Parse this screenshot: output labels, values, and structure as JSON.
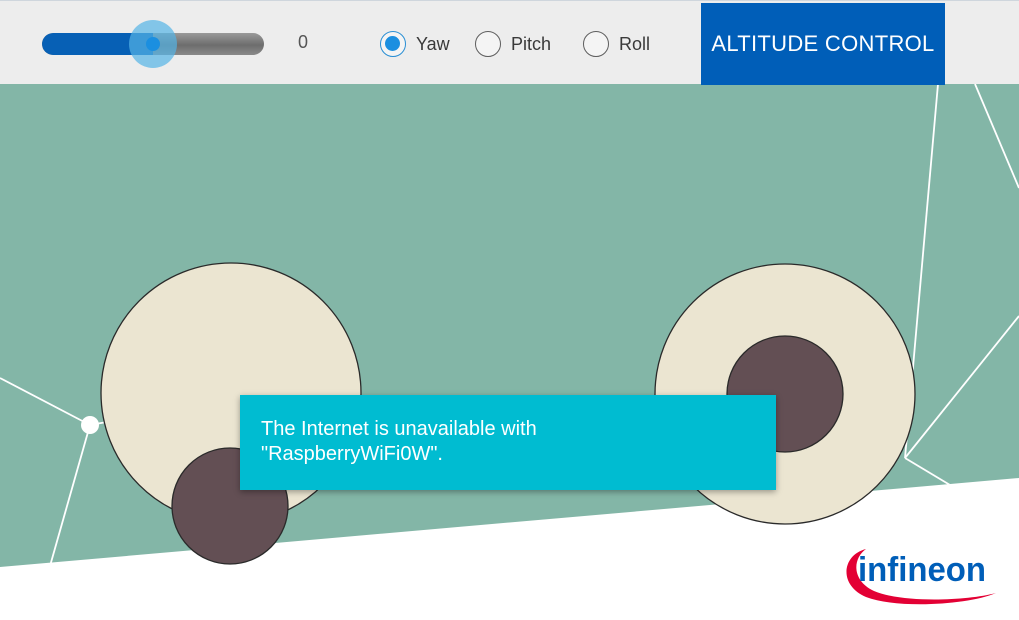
{
  "toolbar": {
    "slider": {
      "value_label": "0",
      "fill_fraction": 0.5
    },
    "radios": [
      {
        "label": "Yaw",
        "checked": true
      },
      {
        "label": "Pitch",
        "checked": false
      },
      {
        "label": "Roll",
        "checked": false
      }
    ],
    "altitude_button_label": "ALTITUDE CONTROL"
  },
  "toast": {
    "line1": "The Internet is unavailable with",
    "line2": "\"RaspberryWiFi0W\"."
  },
  "logo": {
    "text": "infineon"
  },
  "colors": {
    "background_teal": "#83b6a7",
    "joystick_base": "#ebe5d1",
    "joystick_knob": "#634f54",
    "accent_blue": "#005eb8",
    "toast": "#00bcd1"
  }
}
